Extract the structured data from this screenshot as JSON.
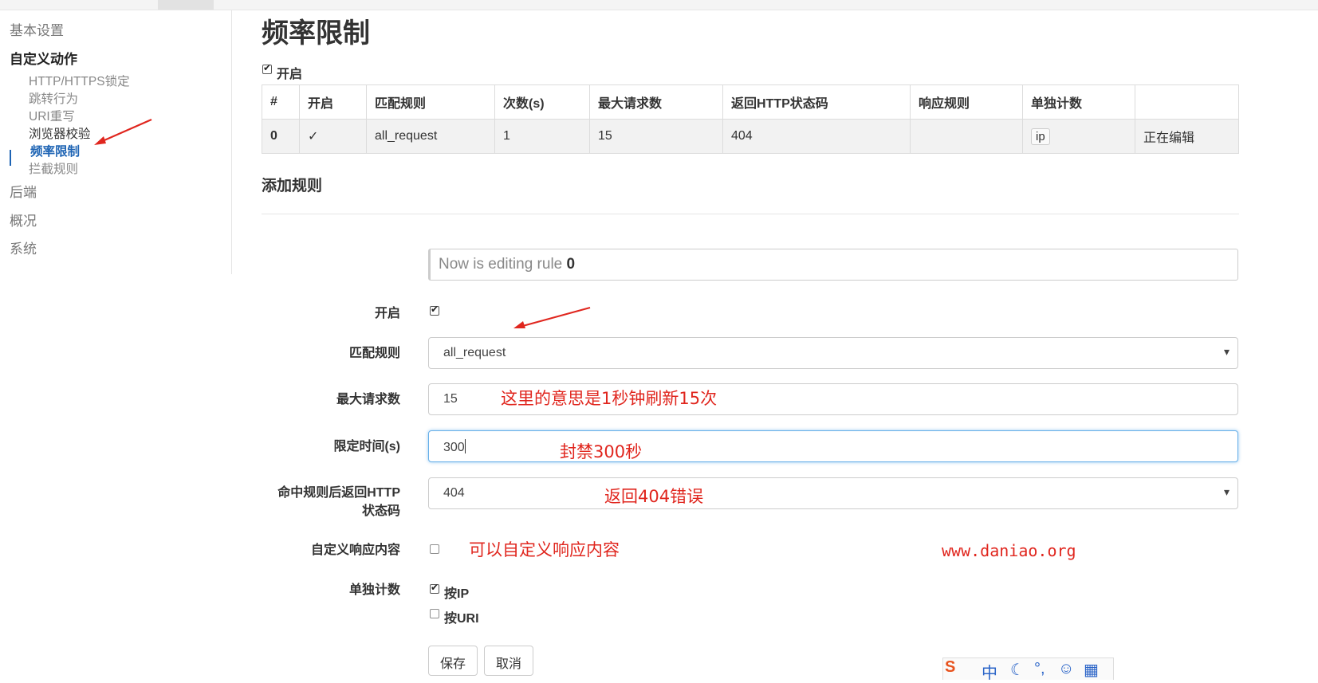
{
  "sidebar": {
    "items": [
      {
        "label": "基本设置"
      },
      {
        "label": "自定义动作"
      },
      {
        "label": "后端"
      },
      {
        "label": "概况"
      },
      {
        "label": "系统"
      }
    ],
    "subitems": [
      {
        "label": "HTTP/HTTPS锁定"
      },
      {
        "label": "跳转行为"
      },
      {
        "label": "URI重写"
      },
      {
        "label": "浏览器校验"
      },
      {
        "label": "频率限制"
      },
      {
        "label": "拦截规则"
      }
    ]
  },
  "page": {
    "title": "频率限制",
    "enable_label": "开启"
  },
  "table": {
    "headers": [
      "#",
      "开启",
      "匹配规则",
      "次数(s)",
      "最大请求数",
      "返回HTTP状态码",
      "响应规则",
      "单独计数",
      ""
    ],
    "row": {
      "index": "0",
      "enabled": "✓",
      "match": "all_request",
      "seconds": "1",
      "max_requests": "15",
      "status": "404",
      "response_rule": "",
      "count_by": "ip",
      "action": "正在编辑"
    }
  },
  "form": {
    "section_title": "添加规则",
    "editing_prefix": "Now is editing rule ",
    "editing_rule": "0",
    "enable_label": "开启",
    "match_label": "匹配规则",
    "match_value": "all_request",
    "max_label": "最大请求数",
    "max_value": "15",
    "time_label": "限定时间(s)",
    "time_value": "300",
    "status_label": "命中规则后返回HTTP状态码",
    "status_value": "404",
    "custom_label": "自定义响应内容",
    "count_label": "单独计数",
    "count_ip": "按IP",
    "count_uri": "按URI",
    "save": "保存",
    "cancel": "取消"
  },
  "annotations": {
    "max_note": "这里的意思是1秒钟刷新15次",
    "time_note": "封禁300秒",
    "status_note": "返回404错误",
    "custom_note": "可以自定义响应内容",
    "site": "www.daniao.org",
    "color": "#e0261e"
  },
  "ime_bar": {
    "lang": "中"
  }
}
